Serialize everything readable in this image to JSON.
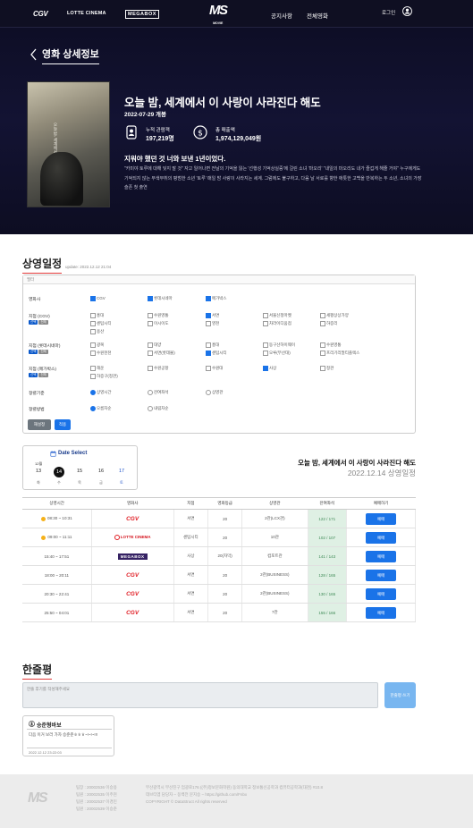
{
  "header": {
    "logos": {
      "cgv": "CGV",
      "lotte": "LOTTE CINEMA",
      "megabox": "MEGABOX",
      "brand": "MS",
      "brand_sub": "MOVIE"
    },
    "nav": [
      "공지사항",
      "전체영화"
    ],
    "login": "로그인"
  },
  "hero": {
    "back_title": "영화 상세정보",
    "poster_text": "오늘 밤, 세계에서 이 사랑이 사라진다 해도",
    "movie_title": "오늘 밤, 세계에서 이 사랑이 사라진다 해도",
    "release_date": "2022-07-29 개봉",
    "audience_label": "누적 관람객",
    "audience_value": "197,219명",
    "sales_label": "총 매출액",
    "sales_value": "1,974,129,049원",
    "tagline": "지워야 했던 것 너와 보낸 1년이었다.",
    "synopsis": "\"카미야 토루에 대해 잊지 말 것\" 자고 일어나면 전날의 기억을 잃는 '선행성 기억상실증'에 걸린 소녀 '마오리' \"내일의 마오리도 내가 즐겁게 해줄 거야\" 누구에게도 기억되지 않는 무색무취의 평범한 소년 '토루' 매일 밤 사랑이 사라지는 세계. 그럼에도 불구하고, 다음 날 서로를 향한 애틋한 고백을 반복하는 두 소년, 소녀의 가장 슬픈 첫 출연"
  },
  "schedule": {
    "heading": "상영일정",
    "updated": "update: 2022.12.12 21:04",
    "filter_head": "필터",
    "rows": [
      {
        "label": "영화사"
      },
      {
        "label": "지점 (CGV)",
        "tags": [
          "선택",
          "전체"
        ]
      },
      {
        "label": "지점 (롯데시네마)",
        "tags": [
          "선택",
          "전체"
        ]
      },
      {
        "label": "지점 (메가박스)",
        "tags": [
          "선택",
          "전체"
        ]
      },
      {
        "label": "정렬기준"
      },
      {
        "label": "정렬방법"
      }
    ],
    "companies": [
      "CGV",
      "롯데시네마",
      "메가박스"
    ],
    "cgv_branches": [
      "홍대",
      "수원영통",
      "서면",
      "서울신정마켓",
      "세평상상가양",
      "센텀시티",
      "이시이도",
      "영천",
      "차라이디움점",
      "하증리",
      "용산"
    ],
    "lotte_branches": [
      "광복",
      "대양",
      "홍대",
      "동구산하이웨이",
      "수원영통",
      "수원천천",
      "서면(롯데몰)",
      "센텀시티",
      "오루(부산대)",
      "프리기리멀티플렉스"
    ],
    "mega_branches": [
      "해운",
      "수원공항",
      "수원대",
      "사상",
      "정관",
      "하증구(정관)"
    ],
    "sort_by": [
      "상영시간",
      "잔여좌석",
      "상영관"
    ],
    "sort_order": [
      "오름차순",
      "내림차순"
    ],
    "reset": "재설정",
    "apply": "적용"
  },
  "date_select": {
    "title": "Date Select",
    "month": "12월",
    "days": [
      {
        "d": "13",
        "w": "화"
      },
      {
        "d": "14",
        "w": "수"
      },
      {
        "d": "15",
        "w": "목"
      },
      {
        "d": "16",
        "w": "금"
      },
      {
        "d": "17",
        "w": "토"
      }
    ],
    "selected_index": 1
  },
  "selection": {
    "movie": "오늘 밤, 세계에서 이 사랑이 사라진다 해도",
    "date": "2022.12.14 상영일정"
  },
  "table": {
    "headers": [
      "상영시간",
      "영화사",
      "지점",
      "영화등급",
      "상영관",
      "잔여좌석",
      "예매하기"
    ],
    "rows": [
      {
        "time": "08:30 ~ 10:31",
        "cinema": "CGV",
        "branch": "서면",
        "rating": "20",
        "hall": "2관(LCX관)",
        "seats": "122 / 171",
        "morning": true
      },
      {
        "time": "09:00 ~ 11:11",
        "cinema": "LOTTE CINEMA",
        "branch": "센텀시티",
        "rating": "20",
        "hall": "10관",
        "seats": "102 / 107",
        "morning": true
      },
      {
        "time": "15:40 ~ 17:51",
        "cinema": "MEGABOX",
        "branch": "사상",
        "rating": "20(자막)",
        "hall": "컴포트관",
        "seats": "141 / 143",
        "morning": false
      },
      {
        "time": "18:00 ~ 20:11",
        "cinema": "CGV",
        "branch": "서면",
        "rating": "20",
        "hall": "2관(BUSINESS)",
        "seats": "128 / 165",
        "morning": false
      },
      {
        "time": "20:30 ~ 22:41",
        "cinema": "CGV",
        "branch": "서면",
        "rating": "20",
        "hall": "2관(BUSINESS)",
        "seats": "130 / 165",
        "morning": false
      },
      {
        "time": "25:50 ~ 04:01",
        "cinema": "CGV",
        "branch": "서면",
        "rating": "20",
        "hall": "7관",
        "seats": "155 / 166",
        "morning": false
      }
    ],
    "book_label": "예매"
  },
  "reviews": {
    "heading": "한줄평",
    "placeholder": "한줄 후기를 작성해주세요",
    "submit": "한줄평 쓰기",
    "items": [
      {
        "user": "승준형바보",
        "text": "다음 이거 보러 가자 승준준ㅎㅎㅎ~!~!~!!!",
        "date": "2022.12.12 23:22:03"
      }
    ]
  },
  "footer": {
    "logo": "MS",
    "team": [
      "팀장 : 20002536 이승용",
      "팀원 : 20002535 이주현",
      "팀원 : 20002537 이경민",
      "팀원 : 20002539 이승준"
    ],
    "address": [
      "부산광역시 부산진구 엄광로176 ((주)정보문화학원) 동의대학교 정보통신공학과 컴퓨터공학과(대천) #10.8",
      "데브티엠 담당자 – 동백전 문지승 – https://github.com/Fnbx",
      "COPYRIGHT © DataStruct All rights reserved"
    ]
  },
  "colors": {
    "hero_bg": "#131333",
    "accent_blue": "#1a73e8",
    "seat_bg": "#dff0e4",
    "cgv_red": "#e01b22",
    "megabox_purple": "#352263"
  }
}
